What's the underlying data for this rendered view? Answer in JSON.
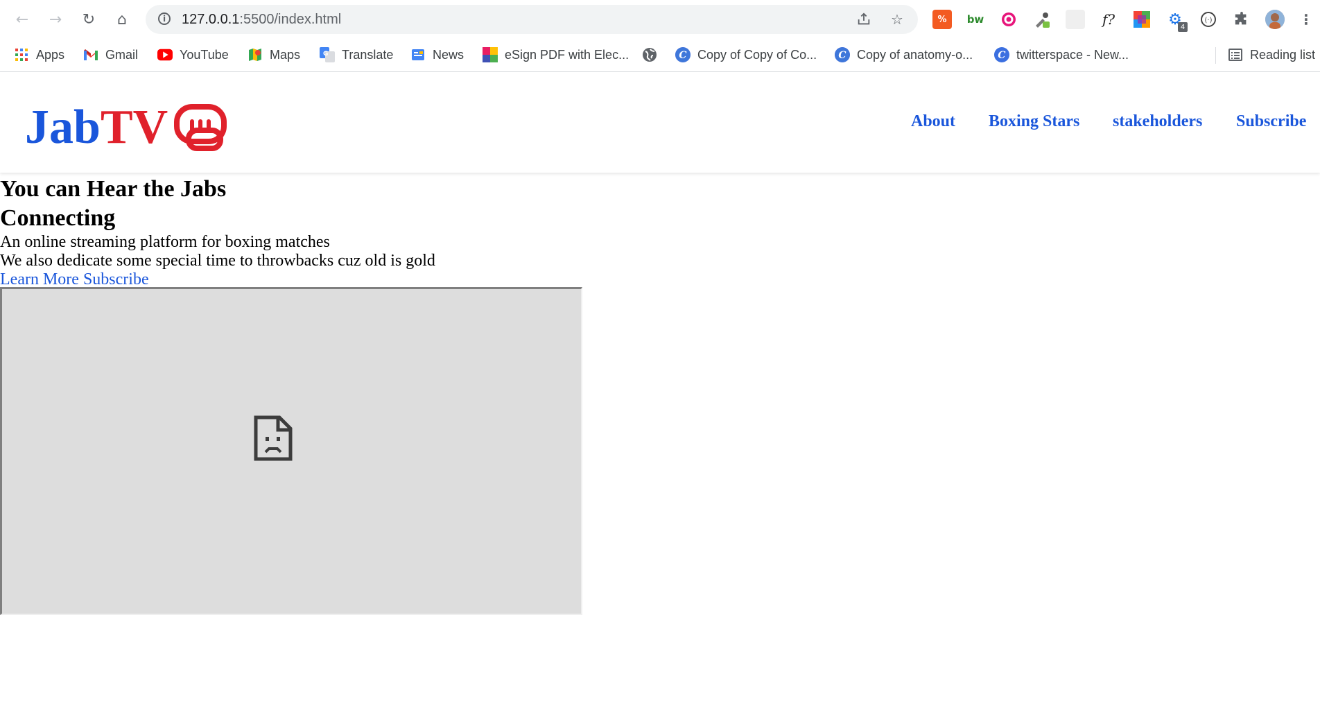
{
  "browser": {
    "url_host": "127.0.0.1",
    "url_path": ":5500/index.html",
    "bookmarks": [
      {
        "label": "Apps",
        "icon": "apps-grid-icon"
      },
      {
        "label": "Gmail",
        "icon": "gmail-icon"
      },
      {
        "label": "YouTube",
        "icon": "youtube-icon"
      },
      {
        "label": "Maps",
        "icon": "maps-icon"
      },
      {
        "label": "Translate",
        "icon": "translate-icon"
      },
      {
        "label": "News",
        "icon": "news-icon"
      },
      {
        "label": "eSign PDF with Elec...",
        "icon": "esign-icon"
      },
      {
        "label": "",
        "icon": "globe-icon"
      },
      {
        "label": "Copy of Copy of Co...",
        "icon": "canva-icon"
      },
      {
        "label": "Copy of anatomy-o...",
        "icon": "canva-icon"
      },
      {
        "label": "twitterspace - New...",
        "icon": "canva-icon"
      }
    ],
    "reading_list": "Reading list",
    "extension_badge": "4",
    "ext_bw": "bw",
    "ext_f": "f?"
  },
  "site": {
    "logo_jab": "Jab",
    "logo_tv": "TV",
    "nav": [
      "About",
      "Boxing Stars",
      "stakeholders",
      "Subscribe"
    ]
  },
  "hero": {
    "heading1": "You can Hear the Jabs",
    "heading2": "Connecting",
    "line1": "An online streaming platform for boxing matches",
    "line2": "We also dedicate some special time to throwbacks cuz old is gold",
    "link_learn": "Learn More",
    "link_subscribe": "Subscribe"
  },
  "colors": {
    "brand_blue": "#1a56db",
    "brand_red": "#e0212b",
    "frame_gray": "#dddddd"
  }
}
